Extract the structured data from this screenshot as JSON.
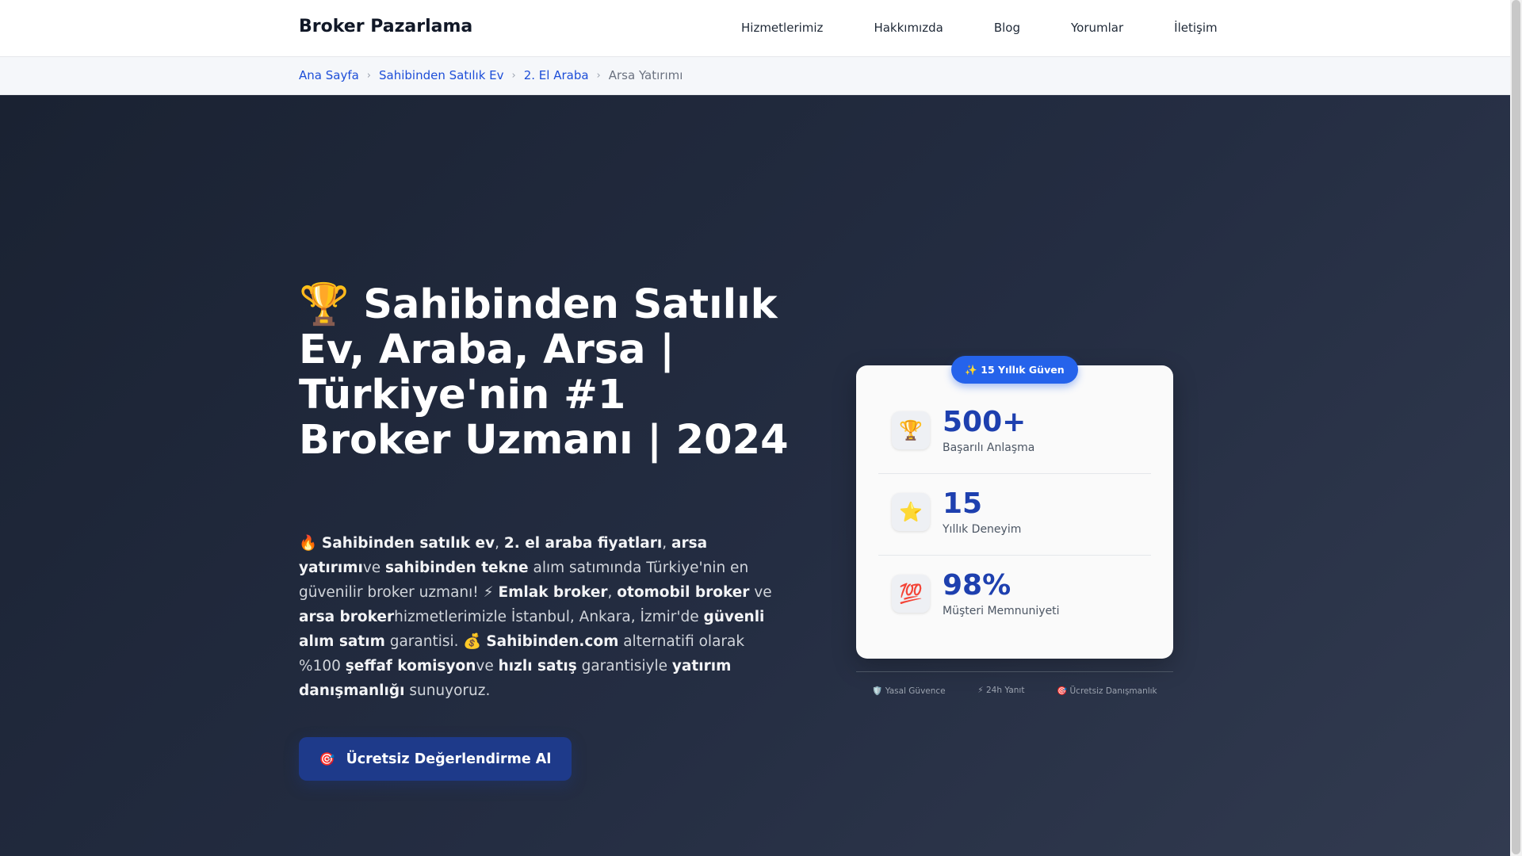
{
  "nav": {
    "brand": "Broker Pazarlama",
    "links": [
      "Hizmetlerimiz",
      "Hakkımızda",
      "Blog",
      "Yorumlar",
      "İletişim"
    ]
  },
  "breadcrumb": {
    "items": [
      "Ana Sayfa",
      "Sahibinden Satılık Ev",
      "2. El Araba"
    ],
    "separator": "›",
    "current": "Arsa Yatırımı"
  },
  "hero": {
    "title": "🏆 Sahibinden Satılık Ev, Araba, Arsa | Türkiye'nin #1 Broker Uzmanı | 2024",
    "description": [
      {
        "t": "🔥 ",
        "b": false
      },
      {
        "t": "Sahibinden satılık ev",
        "b": true
      },
      {
        "t": ", ",
        "b": false
      },
      {
        "t": "2. el araba fiyatları",
        "b": true
      },
      {
        "t": ", ",
        "b": false
      },
      {
        "t": "arsa yatırımı",
        "b": true
      },
      {
        "t": "ve ",
        "b": false
      },
      {
        "t": "sahibinden tekne",
        "b": true
      },
      {
        "t": " alım satımında Türkiye'nin en güvenilir broker uzmanı! ⚡ ",
        "b": false
      },
      {
        "t": "Emlak broker",
        "b": true
      },
      {
        "t": ", ",
        "b": false
      },
      {
        "t": "otomobil broker",
        "b": true
      },
      {
        "t": " ve ",
        "b": false
      },
      {
        "t": "arsa broker",
        "b": true
      },
      {
        "t": "hizmetlerimizle İstanbul, Ankara, İzmir'de ",
        "b": false
      },
      {
        "t": "güvenli alım satım",
        "b": true
      },
      {
        "t": " garantisi. 💰 ",
        "b": false
      },
      {
        "t": "Sahibinden.com",
        "b": true
      },
      {
        "t": " alternatifi olarak %100 ",
        "b": false
      },
      {
        "t": "şeffaf komisyon",
        "b": true
      },
      {
        "t": "ve ",
        "b": false
      },
      {
        "t": "hızlı satış",
        "b": true
      },
      {
        "t": " garantisiyle ",
        "b": false
      },
      {
        "t": "yatırım danışmanlığı",
        "b": true
      },
      {
        "t": " sunuyoruz.",
        "b": false
      }
    ],
    "cta_icon": "🎯",
    "cta_label": "Ücretsiz Değerlendirme Al"
  },
  "stats": {
    "badge": "✨ 15 Yıllık Güven",
    "items": [
      {
        "icon": "🏆",
        "icon_name": "trophy-icon",
        "value": "500+",
        "label": "Başarılı Anlaşma"
      },
      {
        "icon": "⭐",
        "icon_name": "star-icon",
        "value": "15",
        "label": "Yıllık Deneyim"
      },
      {
        "icon": "💯",
        "icon_name": "hundred-points-icon",
        "value": "98%",
        "label": "Müşteri Memnuniyeti"
      }
    ]
  },
  "trust": [
    "🛡️ Yasal Güvence",
    "⚡ 24h Yanıt",
    "🎯 Ücretsiz Danışmanlık"
  ],
  "colors": {
    "brand_blue": "#1e40af",
    "cta_bg": "#1e3a8a",
    "pill_bg": "#2563eb",
    "hero_bg": "#1e2638"
  }
}
